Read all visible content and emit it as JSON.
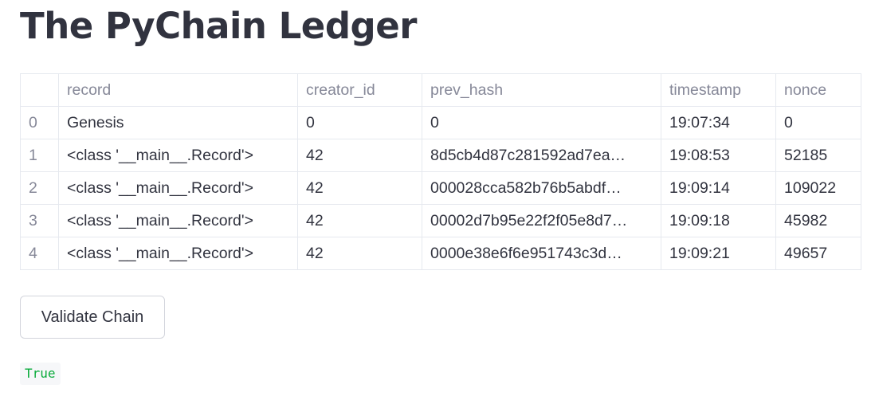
{
  "page": {
    "title": "The PyChain Ledger"
  },
  "table": {
    "columns": [
      "",
      "record",
      "creator_id",
      "prev_hash",
      "timestamp",
      "nonce"
    ],
    "rows": [
      {
        "index": "0",
        "record": "Genesis",
        "creator_id": "0",
        "prev_hash": "0",
        "timestamp": "19:07:34",
        "nonce": "0"
      },
      {
        "index": "1",
        "record": "<class '__main__.Record'>",
        "creator_id": "42",
        "prev_hash": "8d5cb4d87c281592ad7ea…",
        "timestamp": "19:08:53",
        "nonce": "52185"
      },
      {
        "index": "2",
        "record": "<class '__main__.Record'>",
        "creator_id": "42",
        "prev_hash": "000028cca582b76b5abdf…",
        "timestamp": "19:09:14",
        "nonce": "109022"
      },
      {
        "index": "3",
        "record": "<class '__main__.Record'>",
        "creator_id": "42",
        "prev_hash": "00002d7b95e22f2f05e8d7…",
        "timestamp": "19:09:18",
        "nonce": "45982"
      },
      {
        "index": "4",
        "record": "<class '__main__.Record'>",
        "creator_id": "42",
        "prev_hash": "0000e38e6f6e951743c3d…",
        "timestamp": "19:09:21",
        "nonce": "49657"
      }
    ]
  },
  "actions": {
    "validate_label": "Validate Chain"
  },
  "result": {
    "value": "True",
    "color": "#09ab3b"
  }
}
